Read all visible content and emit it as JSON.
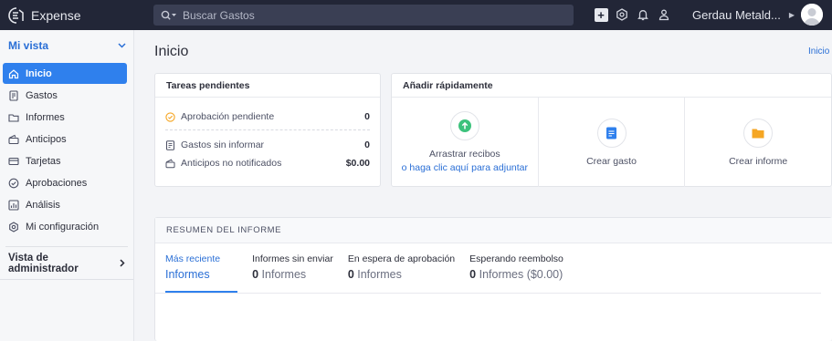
{
  "app": {
    "name": "Expense"
  },
  "search": {
    "placeholder": "Buscar Gastos"
  },
  "header": {
    "company": "Gerdau Metald..."
  },
  "sidebar": {
    "section_title": "Mi vista",
    "items": [
      {
        "label": "Inicio",
        "icon": "home-icon",
        "active": true
      },
      {
        "label": "Gastos",
        "icon": "receipt-icon"
      },
      {
        "label": "Informes",
        "icon": "folder-icon"
      },
      {
        "label": "Anticipos",
        "icon": "wallet-icon"
      },
      {
        "label": "Tarjetas",
        "icon": "card-icon"
      },
      {
        "label": "Aprobaciones",
        "icon": "check-circle-icon"
      },
      {
        "label": "Análisis",
        "icon": "chart-icon"
      },
      {
        "label": "Mi configuración",
        "icon": "gear-icon"
      }
    ],
    "admin_label": "Vista de administrador"
  },
  "main": {
    "title": "Inicio",
    "breadcrumb": "Inicio"
  },
  "tasks": {
    "title": "Tareas pendientes",
    "rows": [
      {
        "label": "Aprobación pendiente",
        "value": "0"
      },
      {
        "label": "Gastos sin informar",
        "value": "0"
      },
      {
        "label": "Anticipos no notificados",
        "value": "$0.00"
      }
    ]
  },
  "quick_add": {
    "title": "Añadir rápidamente",
    "upload_text": "Arrastrar recibos",
    "upload_link": "o haga clic aquí para adjuntar",
    "create_expense": "Crear gasto",
    "create_report": "Crear informe"
  },
  "summary": {
    "title": "RESUMEN DEL INFORME",
    "tabs": [
      {
        "label": "Más reciente",
        "count": "",
        "unit": "Informes",
        "active": true
      },
      {
        "label": "Informes sin enviar",
        "count": "0",
        "unit": "Informes"
      },
      {
        "label": "En espera de aprobación",
        "count": "0",
        "unit": "Informes"
      },
      {
        "label": "Esperando reembolso",
        "count": "0",
        "unit": "Informes ($0.00)"
      }
    ]
  },
  "colors": {
    "accent": "#2f80ed",
    "topbar": "#222637",
    "upload": "#3cc27c",
    "expense": "#2f80ed",
    "report": "#f5a623",
    "pending": "#f5a623"
  }
}
